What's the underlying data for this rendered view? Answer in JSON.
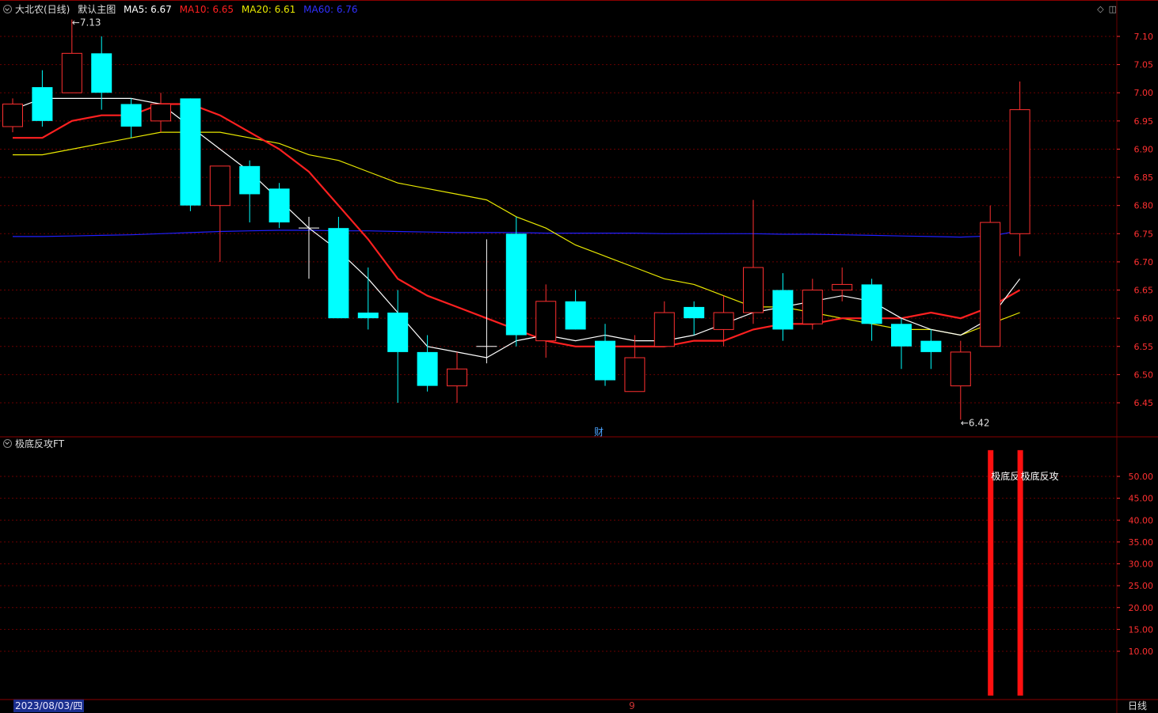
{
  "header": {
    "stock": "大北农(日线)",
    "template": "默认主图",
    "ma5": "MA5: 6.67",
    "ma10": "MA10: 6.65",
    "ma20": "MA20: 6.61",
    "ma60": "MA60: 6.76"
  },
  "colors": {
    "up": "#ff3030",
    "down": "#00ffff",
    "ma5": "#ffffff",
    "ma10": "#ff2020",
    "ma20": "#e8e800",
    "ma60": "#2020ff",
    "grid": "#6a0000",
    "axis_text": "#ff3030",
    "indicator_bar": "#ff1010"
  },
  "indicator": {
    "name": "极底反攻FT",
    "bar_label_1": "极底反攻",
    "bar_label_2": "极底反攻"
  },
  "footer": {
    "date": "2023/08/03/四",
    "month_marker": "9",
    "period": "日线"
  },
  "badges": {
    "fin": "财"
  },
  "icons": [
    "diamond-icon",
    "window-icon"
  ],
  "chart_data": [
    {
      "type": "candlestick",
      "title": "大北农(日线)",
      "ylim": [
        6.4,
        7.15
      ],
      "yticks": [
        6.45,
        6.5,
        6.55,
        6.6,
        6.65,
        6.7,
        6.75,
        6.8,
        6.85,
        6.9,
        6.95,
        7.0,
        7.05,
        7.1
      ],
      "candles": [
        {
          "o": 6.94,
          "h": 6.99,
          "l": 6.93,
          "c": 6.98
        },
        {
          "o": 7.01,
          "h": 7.04,
          "l": 6.94,
          "c": 6.95
        },
        {
          "o": 7.0,
          "h": 7.13,
          "l": 7.0,
          "c": 7.07
        },
        {
          "o": 7.07,
          "h": 7.1,
          "l": 6.97,
          "c": 7.0
        },
        {
          "o": 6.98,
          "h": 6.99,
          "l": 6.92,
          "c": 6.94
        },
        {
          "o": 6.95,
          "h": 7.0,
          "l": 6.93,
          "c": 6.98
        },
        {
          "o": 6.99,
          "h": 6.99,
          "l": 6.79,
          "c": 6.8
        },
        {
          "o": 6.8,
          "h": 6.87,
          "l": 6.7,
          "c": 6.87
        },
        {
          "o": 6.87,
          "h": 6.88,
          "l": 6.77,
          "c": 6.82
        },
        {
          "o": 6.83,
          "h": 6.84,
          "l": 6.76,
          "c": 6.77
        },
        {
          "o": 6.76,
          "h": 6.78,
          "l": 6.67,
          "c": 6.76
        },
        {
          "o": 6.76,
          "h": 6.78,
          "l": 6.6,
          "c": 6.6
        },
        {
          "o": 6.61,
          "h": 6.69,
          "l": 6.58,
          "c": 6.6
        },
        {
          "o": 6.61,
          "h": 6.65,
          "l": 6.45,
          "c": 6.54
        },
        {
          "o": 6.54,
          "h": 6.57,
          "l": 6.47,
          "c": 6.48
        },
        {
          "o": 6.48,
          "h": 6.54,
          "l": 6.45,
          "c": 6.51
        },
        {
          "o": 6.55,
          "h": 6.74,
          "l": 6.52,
          "c": 6.55
        },
        {
          "o": 6.75,
          "h": 6.78,
          "l": 6.55,
          "c": 6.57
        },
        {
          "o": 6.56,
          "h": 6.66,
          "l": 6.53,
          "c": 6.63
        },
        {
          "o": 6.63,
          "h": 6.65,
          "l": 6.58,
          "c": 6.58
        },
        {
          "o": 6.56,
          "h": 6.59,
          "l": 6.48,
          "c": 6.49
        },
        {
          "o": 6.47,
          "h": 6.57,
          "l": 6.47,
          "c": 6.53
        },
        {
          "o": 6.55,
          "h": 6.63,
          "l": 6.55,
          "c": 6.61
        },
        {
          "o": 6.62,
          "h": 6.63,
          "l": 6.57,
          "c": 6.6
        },
        {
          "o": 6.58,
          "h": 6.64,
          "l": 6.55,
          "c": 6.61
        },
        {
          "o": 6.61,
          "h": 6.81,
          "l": 6.59,
          "c": 6.69
        },
        {
          "o": 6.65,
          "h": 6.68,
          "l": 6.56,
          "c": 6.58
        },
        {
          "o": 6.59,
          "h": 6.67,
          "l": 6.58,
          "c": 6.65
        },
        {
          "o": 6.65,
          "h": 6.69,
          "l": 6.63,
          "c": 6.66
        },
        {
          "o": 6.66,
          "h": 6.67,
          "l": 6.56,
          "c": 6.59
        },
        {
          "o": 6.59,
          "h": 6.6,
          "l": 6.51,
          "c": 6.55
        },
        {
          "o": 6.56,
          "h": 6.58,
          "l": 6.51,
          "c": 6.54
        },
        {
          "o": 6.48,
          "h": 6.56,
          "l": 6.42,
          "c": 6.54
        },
        {
          "o": 6.55,
          "h": 6.8,
          "l": 6.55,
          "c": 6.77
        },
        {
          "o": 6.75,
          "h": 7.02,
          "l": 6.71,
          "c": 6.97
        }
      ],
      "ma": {
        "MA5": [
          6.97,
          6.99,
          6.99,
          6.99,
          6.99,
          6.98,
          6.94,
          6.9,
          6.86,
          6.81,
          6.76,
          6.72,
          6.67,
          6.61,
          6.55,
          6.54,
          6.53,
          6.56,
          6.57,
          6.56,
          6.57,
          6.56,
          6.56,
          6.57,
          6.59,
          6.61,
          6.62,
          6.63,
          6.64,
          6.63,
          6.6,
          6.58,
          6.57,
          6.6,
          6.67
        ],
        "MA10": [
          6.92,
          6.92,
          6.95,
          6.96,
          6.96,
          6.98,
          6.98,
          6.96,
          6.93,
          6.9,
          6.86,
          6.8,
          6.74,
          6.67,
          6.64,
          6.62,
          6.6,
          6.58,
          6.56,
          6.55,
          6.55,
          6.55,
          6.55,
          6.56,
          6.56,
          6.58,
          6.59,
          6.59,
          6.6,
          6.6,
          6.6,
          6.61,
          6.6,
          6.62,
          6.65
        ],
        "MA20": [
          6.89,
          6.89,
          6.9,
          6.91,
          6.92,
          6.93,
          6.93,
          6.93,
          6.92,
          6.91,
          6.89,
          6.88,
          6.86,
          6.84,
          6.83,
          6.82,
          6.81,
          6.78,
          6.76,
          6.73,
          6.71,
          6.69,
          6.67,
          6.66,
          6.64,
          6.62,
          6.62,
          6.61,
          6.6,
          6.59,
          6.58,
          6.58,
          6.57,
          6.59,
          6.61
        ],
        "MA60": [
          6.745,
          6.745,
          6.746,
          6.747,
          6.748,
          6.75,
          6.752,
          6.754,
          6.755,
          6.756,
          6.756,
          6.755,
          6.755,
          6.754,
          6.753,
          6.752,
          6.752,
          6.752,
          6.751,
          6.751,
          6.751,
          6.751,
          6.75,
          6.75,
          6.75,
          6.75,
          6.749,
          6.749,
          6.748,
          6.747,
          6.746,
          6.745,
          6.744,
          6.746,
          6.755
        ]
      },
      "annotations": [
        {
          "label": "7.13",
          "index": 2,
          "value": 7.13
        },
        {
          "label": "6.42",
          "index": 32,
          "value": 6.42
        }
      ]
    },
    {
      "type": "bar",
      "title": "极底反攻FT",
      "ylim": [
        0,
        57
      ],
      "yticks": [
        10,
        15,
        20,
        25,
        30,
        35,
        40,
        45,
        50
      ],
      "ytick_labels": [
        "10.00",
        "15.00",
        "20.00",
        "25.00",
        "30.00",
        "35.00",
        "40.00",
        "45.00",
        "50.00"
      ],
      "bars": [
        {
          "index": 33,
          "value": 56
        },
        {
          "index": 34,
          "value": 56
        }
      ]
    }
  ]
}
